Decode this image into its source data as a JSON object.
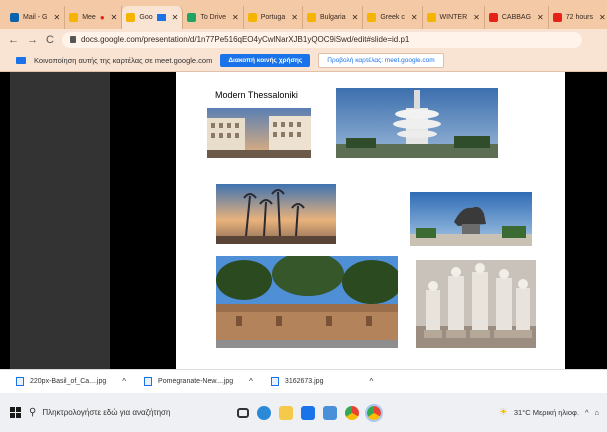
{
  "colors": {
    "tabstrip": "#f4c9a6",
    "accent": "#1a73e8"
  },
  "tabs": [
    {
      "label": "Mail - G",
      "icon": "outlook-icon",
      "color": "#0a64ad"
    },
    {
      "label": "Mee",
      "icon": "meet-icon",
      "color": "#f5b400"
    },
    {
      "label": "Goo",
      "icon": "slides-icon",
      "color": "#f4b400",
      "active": true
    },
    {
      "label": "To Drive",
      "icon": "drive-icon",
      "color": "#1fa463"
    },
    {
      "label": "Portuga",
      "icon": "slides-icon",
      "color": "#f4b400"
    },
    {
      "label": "Bulgaria",
      "icon": "slides-icon",
      "color": "#f4b400"
    },
    {
      "label": "Greek c",
      "icon": "slides-icon",
      "color": "#f4b400"
    },
    {
      "label": "WINTER",
      "icon": "slides-icon",
      "color": "#f4b400"
    },
    {
      "label": "CABBAG",
      "icon": "youtube-icon",
      "color": "#e62117"
    },
    {
      "label": "72 hours",
      "icon": "youtube-icon",
      "color": "#e62117"
    }
  ],
  "url": "docs.google.com/presentation/d/1n77Pe516qEO4yCwlNarXJB1yQOC9iSwd/edit#slide=id.p1",
  "infobar": {
    "message": "Κοινοποίηση αυτής της καρτέλας σε meet.google.com",
    "stop_label": "Διακοπή κοινής χρήσης",
    "show_label": "Προβολή καρτέλας: meet.google.com"
  },
  "slide": {
    "title": "Modern Thessaloniki"
  },
  "downloads": [
    {
      "name": "220px-Basil_of_Ca....jpg"
    },
    {
      "name": "Pomegranate-New....jpg"
    },
    {
      "name": "3162673.jpg"
    }
  ],
  "taskbar": {
    "search_placeholder": "Πληκτρολογήστε εδώ για αναζήτηση",
    "weather": "31°C  Μερική ηλιοφ."
  }
}
